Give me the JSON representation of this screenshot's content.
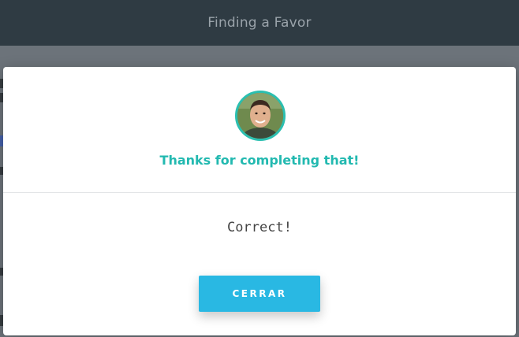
{
  "topbar": {
    "title": "Finding a Favor"
  },
  "modal": {
    "avatar_icon": "user-avatar-photo",
    "heading": "Thanks for completing that!",
    "result_text": "Correct!",
    "close_label": "CERRAR"
  },
  "colors": {
    "topbar": "#2f3b43",
    "accent_teal": "#22b9b0",
    "button_blue": "#29b8e3",
    "overlay": "#6c737a"
  }
}
